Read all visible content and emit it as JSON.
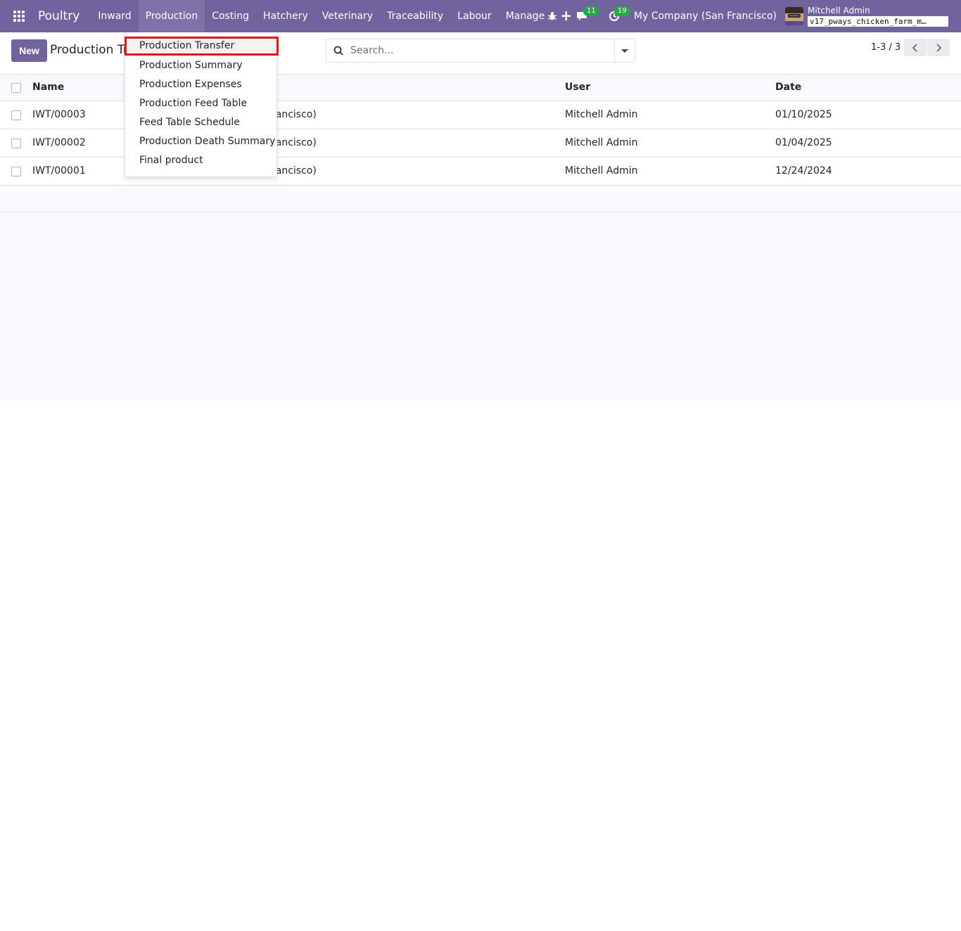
{
  "navbar": {
    "brand": "Poultry",
    "menu": [
      "Inward",
      "Production",
      "Costing",
      "Hatchery",
      "Veterinary",
      "Traceability",
      "Labour",
      "Manage"
    ],
    "messages_badge": "11",
    "activities_badge": "19",
    "company": "My Company (San Francisco)",
    "user_name": "Mitchell Admin",
    "db_name": "v17_pways_chicken_farm_m…"
  },
  "control_panel": {
    "new_label": "New",
    "breadcrumb": "Production Tr",
    "search_placeholder": "Search...",
    "pager": "1-3 / 3"
  },
  "list": {
    "columns": [
      "Name",
      "User",
      "Date"
    ],
    "rows": [
      {
        "name": "IWT/00003",
        "company": "rancisco)",
        "user": "Mitchell Admin",
        "date": "01/10/2025"
      },
      {
        "name": "IWT/00002",
        "company": "rancisco)",
        "user": "Mitchell Admin",
        "date": "01/04/2025"
      },
      {
        "name": "IWT/00001",
        "company": "rancisco)",
        "user": "Mitchell Admin",
        "date": "12/24/2024"
      }
    ]
  },
  "production_menu": {
    "items": [
      "Production Transfer",
      "Production Summary",
      "Production Expenses",
      "Production Feed Table",
      "Feed Table Schedule",
      "Production Death Summary",
      "Final product"
    ]
  },
  "colors": {
    "navbar": "#71639e",
    "highlight_border": "#e5141a",
    "badge": "#28a745"
  }
}
